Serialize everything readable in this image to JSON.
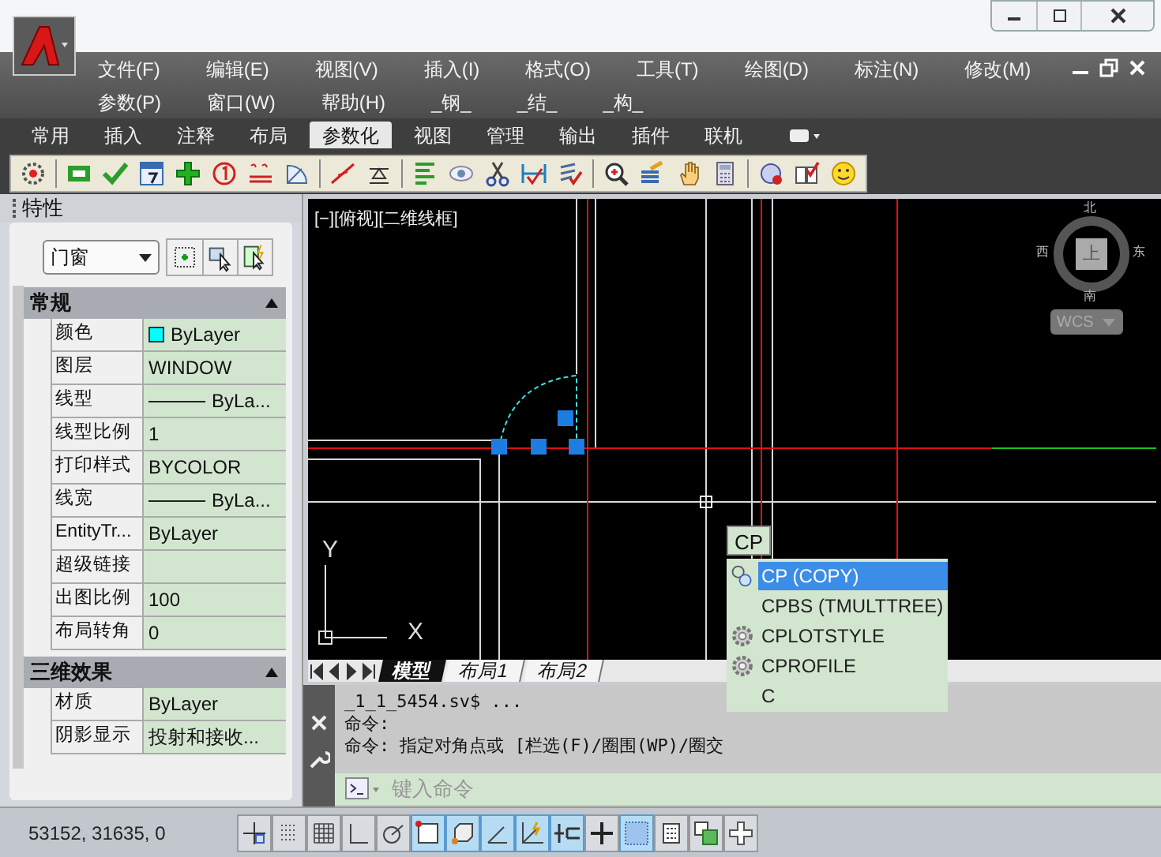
{
  "menu": {
    "rows": [
      [
        "文件(F)",
        "编辑(E)",
        "视图(V)",
        "插入(I)",
        "格式(O)",
        "工具(T)",
        "绘图(D)",
        "标注(N)",
        "修改(M)"
      ],
      [
        "参数(P)",
        "窗口(W)",
        "帮助(H)",
        "_钢_",
        "_结_",
        "_构_"
      ]
    ]
  },
  "ribbon_tabs": [
    {
      "label": "常用",
      "selected": false
    },
    {
      "label": "插入",
      "selected": false
    },
    {
      "label": "注释",
      "selected": false
    },
    {
      "label": "布局",
      "selected": false
    },
    {
      "label": "参数化",
      "selected": true
    },
    {
      "label": "视图",
      "selected": false
    },
    {
      "label": "管理",
      "selected": false
    },
    {
      "label": "输出",
      "selected": false
    },
    {
      "label": "插件",
      "selected": false
    },
    {
      "label": "联机",
      "selected": false
    }
  ],
  "properties_panel": {
    "title": "特性",
    "filter": "门窗",
    "sections": [
      {
        "title": "常规",
        "expanded": true,
        "rows": [
          {
            "kind": "color",
            "label": "颜色",
            "value": "ByLayer",
            "color": "#00ffff"
          },
          {
            "kind": "text",
            "label": "图层",
            "value": "WINDOW"
          },
          {
            "kind": "linetype",
            "label": "线型",
            "value": "ByLa..."
          },
          {
            "kind": "text",
            "label": "线型比例",
            "value": "1"
          },
          {
            "kind": "text",
            "label": "打印样式",
            "value": "BYCOLOR"
          },
          {
            "kind": "linetype",
            "label": "线宽",
            "value": "ByLa..."
          },
          {
            "kind": "text",
            "label": "EntityTr...",
            "value": "ByLayer"
          },
          {
            "kind": "text",
            "label": "超级链接"
          },
          {
            "kind": "text",
            "label": "出图比例",
            "value": "100"
          },
          {
            "kind": "text",
            "label": "布局转角",
            "value": "0"
          }
        ]
      },
      {
        "title": "三维效果",
        "expanded": true,
        "rows": [
          {
            "kind": "text",
            "label": "材质",
            "value": "ByLayer"
          },
          {
            "kind": "text",
            "label": "阴影显示",
            "value": "投射和接收..."
          }
        ]
      }
    ]
  },
  "viewport": {
    "label": "[−][俯视][二维线框]",
    "compass": {
      "north": "北",
      "south": "南",
      "east": "东",
      "west": "西",
      "top": "上"
    },
    "wcs": "WCS",
    "ucs": {
      "x": "X",
      "y": "Y"
    }
  },
  "layout_tabs": [
    {
      "label": "模型",
      "selected": true
    },
    {
      "label": "布局1",
      "selected": false
    },
    {
      "label": "布局2",
      "selected": false
    }
  ],
  "autocomplete": {
    "typed": "CP",
    "items": [
      {
        "kind": "alias",
        "label": "CP (COPY)",
        "selected": true
      },
      {
        "kind": "plain",
        "label": "CPBS (TMULTTREE)",
        "selected": false
      },
      {
        "kind": "command",
        "label": "CPLOTSTYLE",
        "selected": false
      },
      {
        "kind": "command",
        "label": "CPROFILE",
        "selected": false
      },
      {
        "kind": "plain",
        "label": "C",
        "selected": false
      }
    ]
  },
  "command_line": {
    "history": [
      "_1_1_5454.sv$ ...",
      "命令:",
      "命令: 指定对角点或 [栏选(F)/圈围(WP)/圈交"
    ],
    "placeholder": "键入命令"
  },
  "status_bar": {
    "coordinates": "53152, 31635, 0",
    "toggles": [
      {
        "on": false
      },
      {
        "on": false
      },
      {
        "on": false
      },
      {
        "on": false
      },
      {
        "on": false
      },
      {
        "on": true
      },
      {
        "on": true
      },
      {
        "on": true
      },
      {
        "on": true
      },
      {
        "on": true
      },
      {
        "on": false
      },
      {
        "on": true
      },
      {
        "on": false
      },
      {
        "on": false
      },
      {
        "on": false
      }
    ]
  }
}
